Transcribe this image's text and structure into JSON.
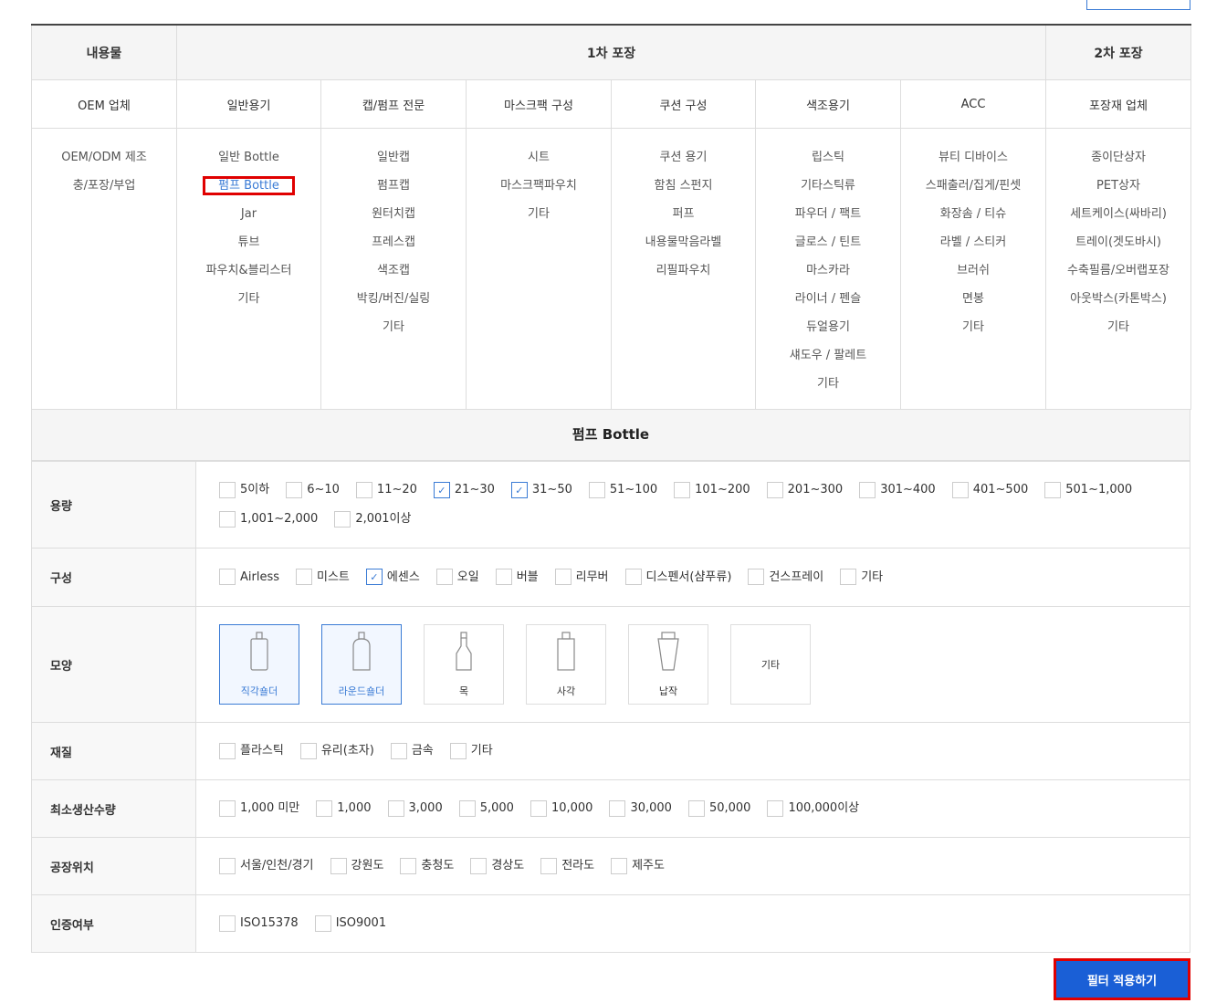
{
  "header": {
    "contents": "내용물",
    "primary": "1차 포장",
    "secondary": "2차 포장"
  },
  "columns": [
    {
      "title": "OEM 업체",
      "items": [
        "OEM/ODM 제조",
        "충/포장/부업"
      ]
    },
    {
      "title": "일반용기",
      "items": [
        "일반 Bottle",
        "펌프 Bottle",
        "Jar",
        "튜브",
        "파우치&블리스터",
        "기타"
      ]
    },
    {
      "title": "캡/펌프 전문",
      "items": [
        "일반캡",
        "펌프캡",
        "원터치캡",
        "프레스캡",
        "색조캡",
        "박킹/버진/실링",
        "기타"
      ]
    },
    {
      "title": "마스크팩 구성",
      "items": [
        "시트",
        "마스크팩파우치",
        "기타"
      ]
    },
    {
      "title": "쿠션 구성",
      "items": [
        "쿠션 용기",
        "함침 스펀지",
        "퍼프",
        "내용물막음라벨",
        "리필파우치"
      ]
    },
    {
      "title": "색조용기",
      "items": [
        "립스틱",
        "기타스틱류",
        "파우더 / 팩트",
        "글로스 / 틴트",
        "마스카라",
        "라이너 / 펜슬",
        "듀얼용기",
        "섀도우 / 팔레트",
        "기타"
      ]
    },
    {
      "title": "ACC",
      "items": [
        "뷰티 디바이스",
        "스패출러/집게/핀셋",
        "화장솜 / 티슈",
        "라벨 / 스티커",
        "브러쉬",
        "면봉",
        "기타"
      ]
    },
    {
      "title": "포장재 업체",
      "items": [
        "종이단상자",
        "PET상자",
        "세트케이스(싸바리)",
        "트레이(겟도바시)",
        "수축필름/오버랩포장",
        "아웃박스(카톤박스)",
        "기타"
      ]
    }
  ],
  "selected_category": "펌프 Bottle",
  "filters": {
    "capacity": {
      "label": "용량",
      "options": [
        {
          "label": "5이하",
          "checked": false
        },
        {
          "label": "6~10",
          "checked": false
        },
        {
          "label": "11~20",
          "checked": false
        },
        {
          "label": "21~30",
          "checked": true
        },
        {
          "label": "31~50",
          "checked": true
        },
        {
          "label": "51~100",
          "checked": false
        },
        {
          "label": "101~200",
          "checked": false
        },
        {
          "label": "201~300",
          "checked": false
        },
        {
          "label": "301~400",
          "checked": false
        },
        {
          "label": "401~500",
          "checked": false
        },
        {
          "label": "501~1,000",
          "checked": false
        },
        {
          "label": "1,001~2,000",
          "checked": false
        },
        {
          "label": "2,001이상",
          "checked": false
        }
      ]
    },
    "composition": {
      "label": "구성",
      "options": [
        {
          "label": "Airless",
          "checked": false
        },
        {
          "label": "미스트",
          "checked": false
        },
        {
          "label": "에센스",
          "checked": true
        },
        {
          "label": "오일",
          "checked": false
        },
        {
          "label": "버블",
          "checked": false
        },
        {
          "label": "리무버",
          "checked": false
        },
        {
          "label": "디스펜서(샴푸류)",
          "checked": false
        },
        {
          "label": "건스프레이",
          "checked": false
        },
        {
          "label": "기타",
          "checked": false
        }
      ]
    },
    "shape": {
      "label": "모양",
      "options": [
        {
          "label": "직각숄더",
          "selected": true,
          "icon": "square-shoulder-bottle-icon"
        },
        {
          "label": "라운드숄더",
          "selected": true,
          "icon": "round-shoulder-bottle-icon"
        },
        {
          "label": "목",
          "selected": false,
          "icon": "neck-bottle-icon"
        },
        {
          "label": "사각",
          "selected": false,
          "icon": "square-bottle-icon"
        },
        {
          "label": "납작",
          "selected": false,
          "icon": "flat-bottle-icon"
        },
        {
          "label": "기타",
          "selected": false,
          "icon": ""
        }
      ]
    },
    "material": {
      "label": "재질",
      "options": [
        {
          "label": "플라스틱",
          "checked": false
        },
        {
          "label": "유리(초자)",
          "checked": false
        },
        {
          "label": "금속",
          "checked": false
        },
        {
          "label": "기타",
          "checked": false
        }
      ]
    },
    "moq": {
      "label": "최소생산수량",
      "options": [
        {
          "label": "1,000 미만",
          "checked": false
        },
        {
          "label": "1,000",
          "checked": false
        },
        {
          "label": "3,000",
          "checked": false
        },
        {
          "label": "5,000",
          "checked": false
        },
        {
          "label": "10,000",
          "checked": false
        },
        {
          "label": "30,000",
          "checked": false
        },
        {
          "label": "50,000",
          "checked": false
        },
        {
          "label": "100,000이상",
          "checked": false
        }
      ]
    },
    "location": {
      "label": "공장위치",
      "options": [
        {
          "label": "서울/인천/경기",
          "checked": false
        },
        {
          "label": "강원도",
          "checked": false
        },
        {
          "label": "충청도",
          "checked": false
        },
        {
          "label": "경상도",
          "checked": false
        },
        {
          "label": "전라도",
          "checked": false
        },
        {
          "label": "제주도",
          "checked": false
        }
      ]
    },
    "certification": {
      "label": "인증여부",
      "options": [
        {
          "label": "ISO15378",
          "checked": false
        },
        {
          "label": "ISO9001",
          "checked": false
        }
      ]
    }
  },
  "apply_button": "필터 적용하기",
  "colors": {
    "accent": "#3a7bd5",
    "button": "#1a5fd6",
    "highlight": "#e00000"
  }
}
